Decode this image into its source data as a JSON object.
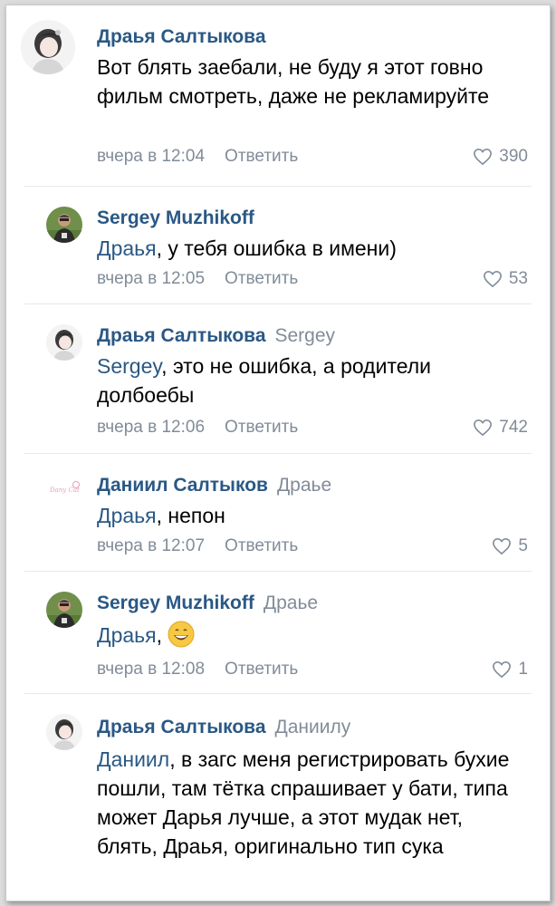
{
  "comments": [
    {
      "author": "Драья Салтыкова",
      "reply_to": "",
      "text": "Вот блять заебали, не буду я этот говно фильм смотреть, даже не рекламируйте",
      "time": "вчера в 12:04",
      "reply_label": "Ответить",
      "likes": "390"
    },
    {
      "author": "Sergey Muzhikoff",
      "reply_to": "",
      "mention": "Драья",
      "text": ", у тебя ошибка в имени)",
      "time": "вчера в 12:05",
      "reply_label": "Ответить",
      "likes": "53"
    },
    {
      "author": "Драья Салтыкова",
      "reply_to": "Sergey",
      "mention": "Sergey",
      "text": ", это не ошибка, а родители долбоебы",
      "time": "вчера в 12:06",
      "reply_label": "Ответить",
      "likes": "742"
    },
    {
      "author": "Даниил Салтыков",
      "reply_to": "Драье",
      "mention": "Драья",
      "text": ", непон",
      "time": "вчера в 12:07",
      "reply_label": "Ответить",
      "likes": "5"
    },
    {
      "author": "Sergey Muzhikoff",
      "reply_to": "Драье",
      "mention": "Драья",
      "text": ",",
      "time": "вчера в 12:08",
      "reply_label": "Ответить",
      "likes": "1"
    },
    {
      "author": "Драья Салтыкова",
      "reply_to": "Даниилу",
      "mention": "Даниил",
      "text": ", в загс меня регистрировать бухие пошли, там тётка спрашивает у бати, типа может Дарья лучше, а этот мудак нет, блять, Драья, оригинально тип сука"
    }
  ],
  "avatar_logo_text": "Dany Cat",
  "colors": {
    "link": "#2a5885",
    "muted": "#818c99",
    "text": "#000000",
    "background": "#ffffff",
    "divider": "#e7e8ec"
  },
  "icons": {
    "like": "heart-outline-icon",
    "emoji": "grinning-face-emoji"
  }
}
